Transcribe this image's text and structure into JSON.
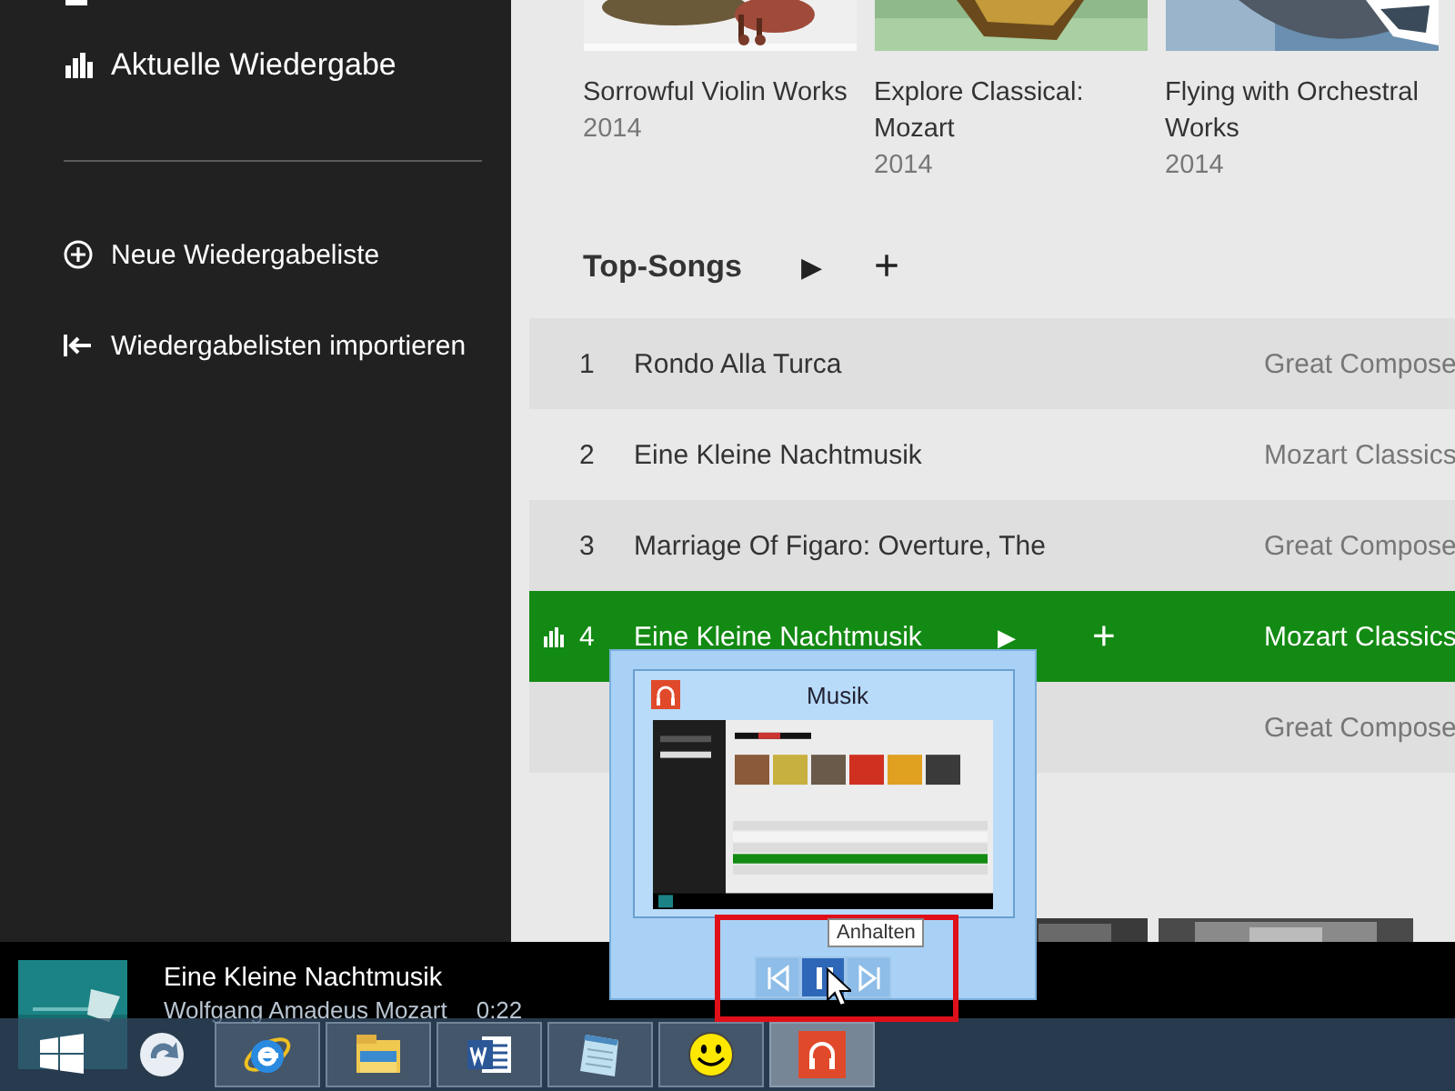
{
  "sidebar": {
    "items": [
      {
        "kind": "explore"
      },
      {
        "kind": "nowplaying",
        "label": "Aktuelle Wiedergabe"
      },
      {
        "kind": "divider"
      },
      {
        "kind": "newlist",
        "label": "Neue Wiedergabeliste"
      },
      {
        "kind": "import",
        "label": "Wiedergabelisten importieren"
      }
    ]
  },
  "albums": [
    {
      "title": "Sorrowful Violin Works",
      "year": "2014"
    },
    {
      "title": "Explore Classical: Mozart",
      "year": "2014"
    },
    {
      "title": "Flying with Orchestral Works",
      "year": "2014"
    }
  ],
  "top_songs": {
    "title": "Top-Songs",
    "play": "▶",
    "add": "+",
    "rows": [
      {
        "number": "1",
        "title": "Rondo Alla Turca",
        "artist": "Great Compose",
        "selected": false
      },
      {
        "number": "2",
        "title": "Eine Kleine Nachtmusik",
        "artist": "Mozart Classics",
        "selected": false
      },
      {
        "number": "3",
        "title": "Marriage Of Figaro: Overture, The",
        "artist": "Great Compose",
        "selected": false
      },
      {
        "number": "4",
        "title": "Eine Kleine Nachtmusik",
        "artist": "Mozart Classics",
        "selected": true,
        "play": "▶",
        "add": "+"
      },
      {
        "artist": "Great Compose",
        "selected": false
      }
    ]
  },
  "now_playing": {
    "title": "Eine Kleine Nachtmusik",
    "artist": "Wolfgang Amadeus Mozart",
    "time": "0:22"
  },
  "thumbnail_popup": {
    "title": "Musik",
    "tooltip": "Anhalten",
    "buttons": [
      {
        "kind": "prev",
        "selected": false
      },
      {
        "kind": "pause",
        "selected": true
      },
      {
        "kind": "next",
        "selected": false
      }
    ]
  },
  "taskbar": {
    "items": [
      {
        "kind": "start",
        "running": false,
        "active": false
      },
      {
        "kind": "refresh",
        "running": false,
        "active": false
      },
      {
        "kind": "browser",
        "running": true,
        "active": false
      },
      {
        "kind": "files",
        "running": true,
        "active": false
      },
      {
        "kind": "word",
        "running": true,
        "active": false
      },
      {
        "kind": "notepad",
        "running": true,
        "active": false
      },
      {
        "kind": "smiley",
        "running": true,
        "active": false
      },
      {
        "kind": "music",
        "running": true,
        "active": true
      }
    ]
  }
}
